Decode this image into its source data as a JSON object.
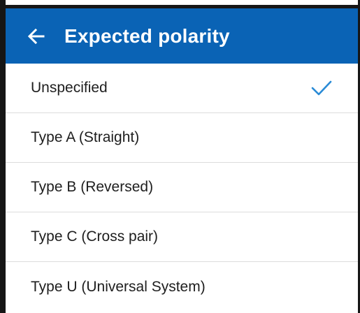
{
  "header": {
    "title": "Expected polarity",
    "back_icon": "arrow-left-icon",
    "background_color": "#0a63b5",
    "text_color": "#ffffff"
  },
  "options": [
    {
      "label": "Unspecified",
      "selected": true
    },
    {
      "label": "Type A (Straight)",
      "selected": false
    },
    {
      "label": "Type B (Reversed)",
      "selected": false
    },
    {
      "label": "Type C (Cross pair)",
      "selected": false
    },
    {
      "label": "Type U (Universal System)",
      "selected": false
    }
  ],
  "selected_icon": "checkmark-icon",
  "accent_color": "#2a8bd6"
}
